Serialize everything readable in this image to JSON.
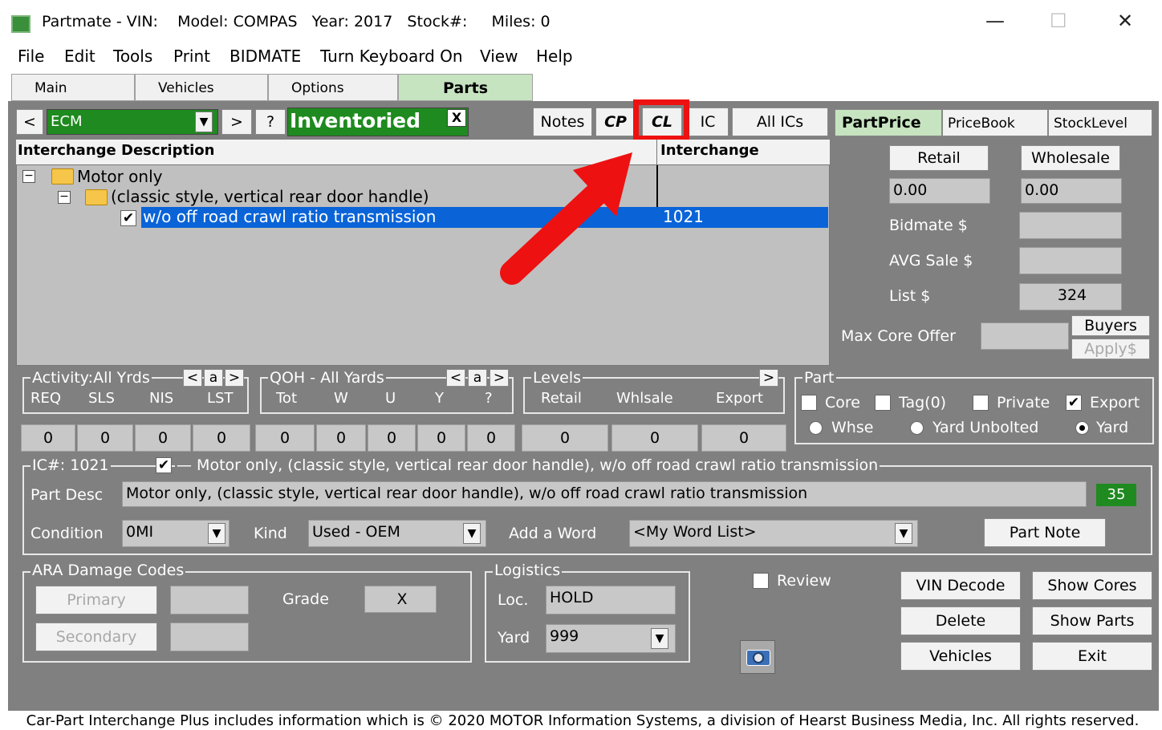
{
  "window": {
    "title": "Partmate - VIN:    Model: COMPAS   Year: 2017   Stock#:     Miles: 0",
    "minimize": "—",
    "maximize": "☐",
    "close": "✕"
  },
  "menu": [
    "File",
    "Edit",
    "Tools",
    "Print",
    "BIDMATE",
    "Turn Keyboard On",
    "View",
    "Help"
  ],
  "tabs": [
    "Main",
    "Vehicles",
    "Options",
    "Parts"
  ],
  "toolbar": {
    "prev": "<",
    "part_type": "ECM",
    "next": ">",
    "help": "?",
    "status": "Inventoried",
    "status_close": "X",
    "notes": "Notes",
    "cp": "CP",
    "cl": "CL",
    "ic": "IC",
    "all_ics": "All ICs"
  },
  "price_tabs": [
    "PartPrice",
    "PriceBook",
    "StockLevel"
  ],
  "grid": {
    "col_desc": "Interchange Description",
    "col_ic": "Interchange",
    "rows": [
      {
        "text": "Motor only",
        "ic": ""
      },
      {
        "text": "(classic style, vertical rear door handle)",
        "ic": ""
      },
      {
        "text": "w/o off road crawl ratio transmission",
        "ic": "1021"
      }
    ]
  },
  "pricing": {
    "retail_btn": "Retail",
    "wholesale_btn": "Wholesale",
    "retail_val": "0.00",
    "wholesale_val": "0.00",
    "bidmate": "Bidmate $",
    "avg_sale": "AVG Sale $",
    "list": "List $",
    "list_val": "324",
    "max_core": "Max Core Offer",
    "buyers": "Buyers",
    "apply": "Apply$"
  },
  "activity": {
    "title": "Activity:All Yrds",
    "nav": [
      "<",
      "a",
      ">"
    ],
    "cols": [
      "REQ",
      "SLS",
      "NIS",
      "LST"
    ],
    "vals": [
      "0",
      "0",
      "0",
      "0"
    ]
  },
  "qoh": {
    "title": "QOH - All Yards",
    "nav": [
      "<",
      "a",
      ">"
    ],
    "cols": [
      "Tot",
      "W",
      "U",
      "Y",
      "?"
    ],
    "vals": [
      "0",
      "0",
      "0",
      "0",
      "0"
    ]
  },
  "levels": {
    "title": "Levels",
    "nav": ">",
    "cols": [
      "Retail",
      "Whlsale",
      "Export"
    ],
    "vals": [
      "0",
      "0",
      "0"
    ]
  },
  "part": {
    "title": "Part",
    "core": "Core",
    "tag": "Tag(0)",
    "private": "Private",
    "export": "Export",
    "whse": "Whse",
    "yard_unbolted": "Yard Unbolted",
    "yard": "Yard"
  },
  "ic_section": {
    "title": "IC#: 1021",
    "desc_full": "Motor only, (classic style, vertical rear door handle), w/o off road crawl ratio transmission",
    "part_desc_label": "Part Desc",
    "part_desc_val": "Motor only, (classic style, vertical rear door handle), w/o off road crawl ratio transmission",
    "count": "35",
    "condition_label": "Condition",
    "condition_val": "0MI",
    "kind_label": "Kind",
    "kind_val": "Used - OEM",
    "add_word_label": "Add a Word",
    "add_word_val": "<My Word List>",
    "part_note": "Part Note"
  },
  "ara": {
    "title": "ARA Damage Codes",
    "primary": "Primary",
    "secondary": "Secondary",
    "grade": "Grade",
    "grade_val": "X"
  },
  "logistics": {
    "title": "Logistics",
    "loc_label": "Loc.",
    "loc_val": "HOLD",
    "yard_label": "Yard",
    "yard_val": "999"
  },
  "review": "Review",
  "actions": [
    "VIN Decode",
    "Show Cores",
    "Delete",
    "Show Parts",
    "Vehicles",
    "Exit"
  ],
  "footer": "Car-Part Interchange Plus includes information which is © 2020 MOTOR Information Systems, a division of Hearst Business Media, Inc.  All rights reserved.",
  "colors": {
    "panel": "#808080",
    "status_green": "#1f8a1f",
    "selection": "#0a64d8",
    "highlight_red": "#ee1111"
  }
}
